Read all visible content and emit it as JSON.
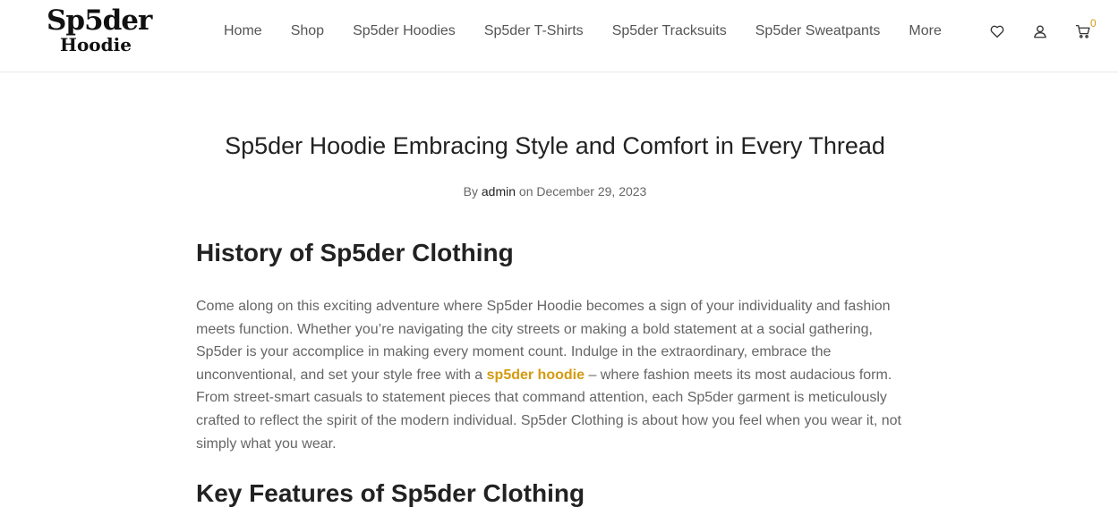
{
  "header": {
    "logo_line1": "Sp5der",
    "logo_line2": "Hoodie",
    "nav": [
      {
        "label": "Home"
      },
      {
        "label": "Shop"
      },
      {
        "label": "Sp5der Hoodies"
      },
      {
        "label": "Sp5der T-Shirts"
      },
      {
        "label": "Sp5der Tracksuits"
      },
      {
        "label": "Sp5der Sweatpants"
      },
      {
        "label": "More"
      }
    ],
    "icons": {
      "wishlist": "heart-icon",
      "account": "user-icon",
      "cart": "cart-icon"
    },
    "cart_count": "0"
  },
  "post": {
    "title": "Sp5der Hoodie Embracing Style and Comfort in Every Thread",
    "meta_by": "By",
    "author": "admin",
    "meta_on": "on",
    "date": "December 29, 2023",
    "heading1": "History of Sp5der Clothing",
    "para_part1": "Come along on this exciting adventure where Sp5der Hoodie becomes a sign of your individuality and fashion meets function. Whether you’re navigating the city streets or making a bold statement at a social gathering, Sp5der is your accomplice in making every moment count. Indulge in the extraordinary, embrace the unconventional, and set your style free with a ",
    "para_link": "sp5der hoodie",
    "para_part2": " – where fashion meets its most audacious form. From street-smart casuals to statement pieces that command attention, each Sp5der garment is meticulously crafted to reflect the spirit of the modern individual.  Sp5der Clothing is about how you feel when you wear it, not simply what you wear.",
    "heading2": "Key Features of Sp5der Clothing"
  },
  "colors": {
    "accent": "#d49a0f",
    "text": "#666666",
    "heading": "#222222"
  }
}
